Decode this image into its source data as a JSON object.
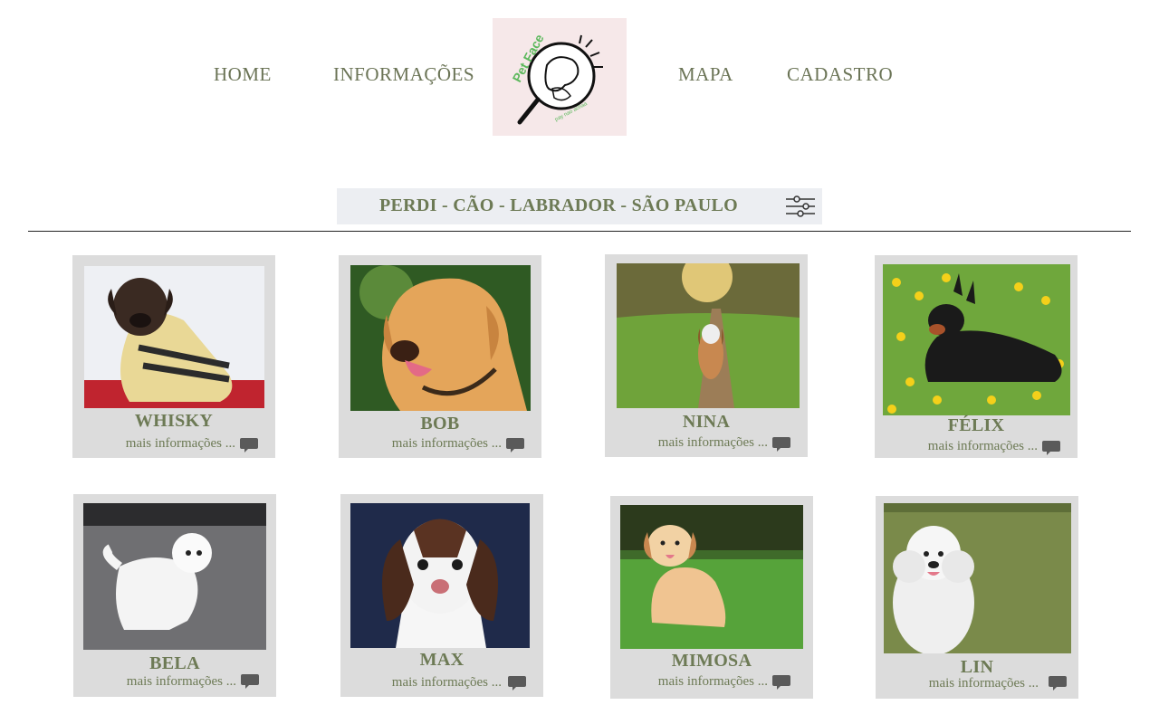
{
  "nav": {
    "home": "HOME",
    "info": "INFORMAÇÕES",
    "map": "MAPA",
    "signup": "CADASTRO"
  },
  "logo": {
    "title": "Pet Face",
    "tagline": "pay nao achaa"
  },
  "filter": {
    "text": "PERDI - CÃO - LABRADOR - SÃO PAULO",
    "icon": "sliders-icon"
  },
  "cards": [
    {
      "name": "WHISKY",
      "more": "mais informações ...",
      "icon": "comment-icon"
    },
    {
      "name": "BOB",
      "more": "mais informações ...",
      "icon": "comment-icon"
    },
    {
      "name": "NINA",
      "more": "mais informações ...",
      "icon": "comment-icon"
    },
    {
      "name": "FÉLIX",
      "more": "mais informações ...",
      "icon": "comment-icon"
    },
    {
      "name": "BELA",
      "more": "mais informações ...",
      "icon": "comment-icon"
    },
    {
      "name": "MAX",
      "more": "mais informações ...",
      "icon": "comment-icon"
    },
    {
      "name": "MIMOSA",
      "more": "mais informações ...",
      "icon": "comment-icon"
    },
    {
      "name": "LIN",
      "more": "mais informações ...",
      "icon": "comment-icon"
    }
  ],
  "colors": {
    "text": "#6d7a55",
    "card": "#dcdcdc",
    "logo_bg": "#f6e8e9",
    "filter_bg": "#eceef2"
  }
}
